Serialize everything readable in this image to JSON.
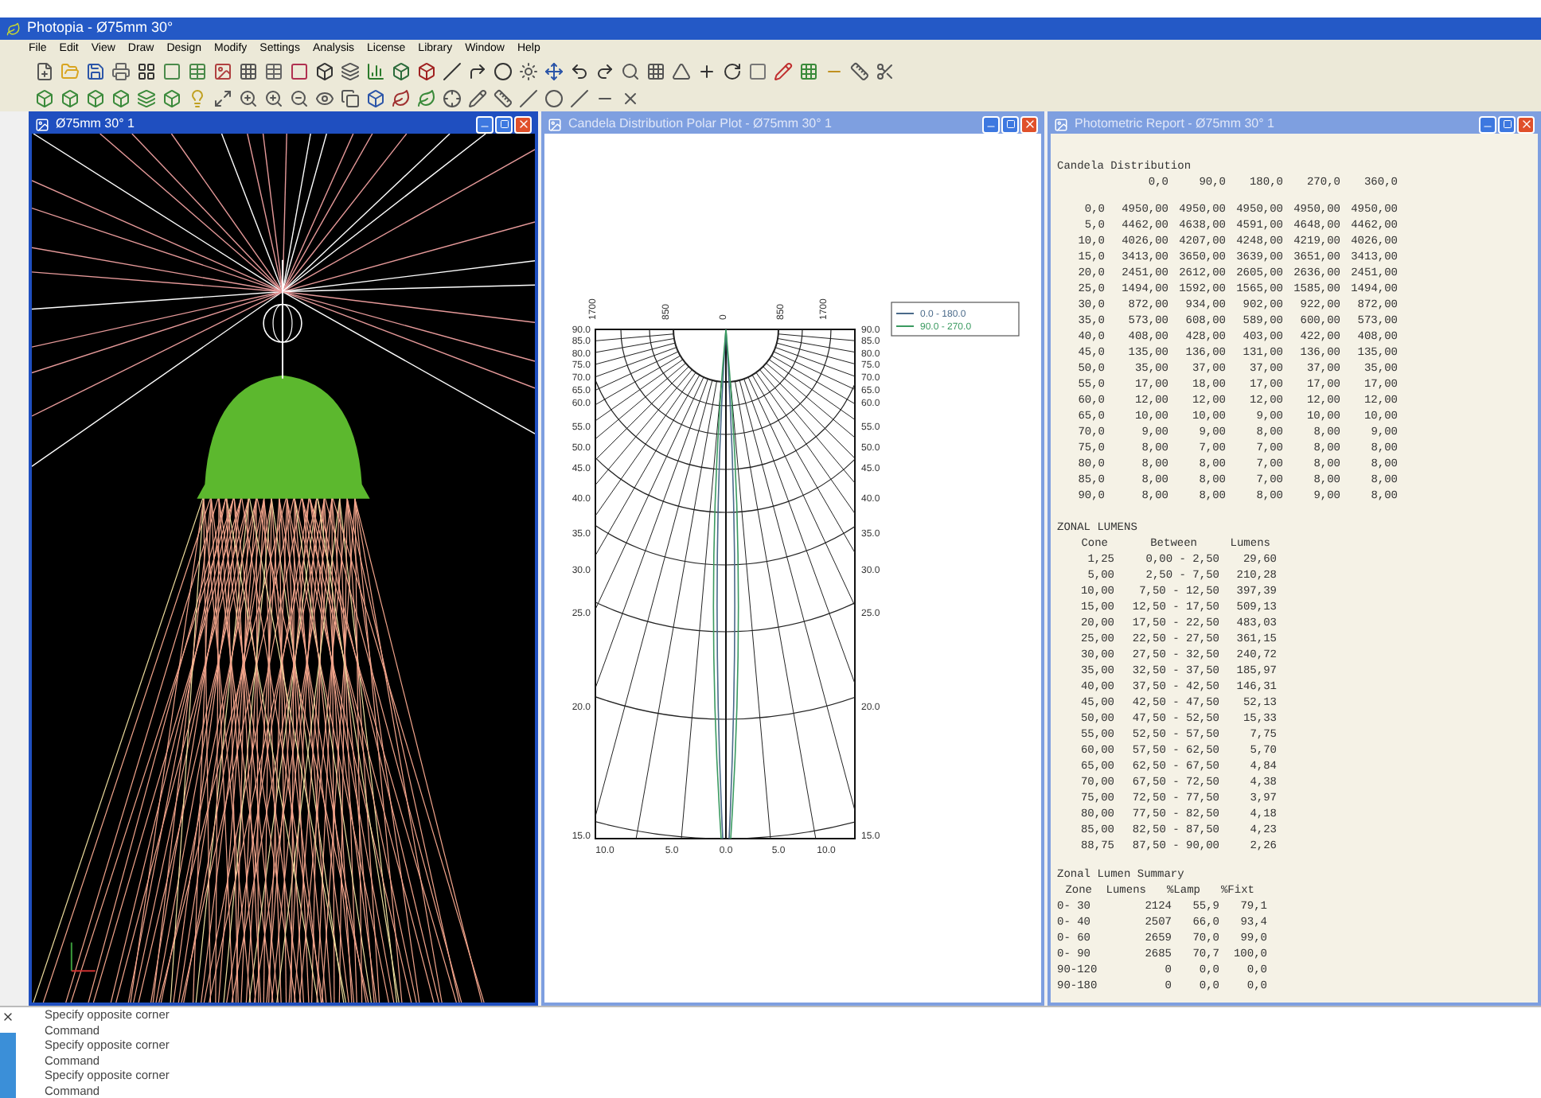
{
  "window": {
    "title": "Photopia - Ø75mm 30°"
  },
  "menu": [
    "File",
    "Edit",
    "View",
    "Draw",
    "Design",
    "Modify",
    "Settings",
    "Analysis",
    "License",
    "Library",
    "Window",
    "Help"
  ],
  "child_windows": [
    {
      "kind": "render",
      "title": "Ø75mm 30° 1",
      "selected": true
    },
    {
      "kind": "polar",
      "title": "Candela Distribution Polar Plot - Ø75mm 30° 1",
      "selected": false,
      "legend": [
        {
          "label": "0.0 - 180.0",
          "color": "#4a6a8a"
        },
        {
          "label": "90.0 - 270.0",
          "color": "#3a9a60"
        }
      ],
      "top_axis": [
        "1700",
        "850",
        "0",
        "850",
        "1700"
      ],
      "left_axis": [
        "90.0",
        "85.0",
        "80.0",
        "75.0",
        "70.0",
        "65.0",
        "60.0",
        "55.0",
        "50.0",
        "45.0",
        "40.0",
        "35.0",
        "30.0",
        "25.0",
        "20.0",
        "15.0"
      ],
      "right_axis": [
        "90.0",
        "85.0",
        "80.0",
        "75.0",
        "70.0",
        "65.0",
        "60.0",
        "55.0",
        "50.0",
        "45.0",
        "40.0",
        "35.0",
        "30.0",
        "25.0",
        "20.0",
        "15.0"
      ],
      "bottom_axis": [
        "10.0",
        "5.0",
        "0.0",
        "5.0",
        "10.0"
      ]
    },
    {
      "kind": "report",
      "title": "Photometric Report - Ø75mm 30° 1",
      "selected": false,
      "candela": {
        "title": "Candela Distribution",
        "columns": [
          "",
          "0,0",
          "90,0",
          "180,0",
          "270,0",
          "360,0"
        ],
        "rows": [
          [
            "0,0",
            "4950,00",
            "4950,00",
            "4950,00",
            "4950,00",
            "4950,00"
          ],
          [
            "5,0",
            "4462,00",
            "4638,00",
            "4591,00",
            "4648,00",
            "4462,00"
          ],
          [
            "10,0",
            "4026,00",
            "4207,00",
            "4248,00",
            "4219,00",
            "4026,00"
          ],
          [
            "15,0",
            "3413,00",
            "3650,00",
            "3639,00",
            "3651,00",
            "3413,00"
          ],
          [
            "20,0",
            "2451,00",
            "2612,00",
            "2605,00",
            "2636,00",
            "2451,00"
          ],
          [
            "25,0",
            "1494,00",
            "1592,00",
            "1565,00",
            "1585,00",
            "1494,00"
          ],
          [
            "30,0",
            "872,00",
            "934,00",
            "902,00",
            "922,00",
            "872,00"
          ],
          [
            "35,0",
            "573,00",
            "608,00",
            "589,00",
            "600,00",
            "573,00"
          ],
          [
            "40,0",
            "408,00",
            "428,00",
            "403,00",
            "422,00",
            "408,00"
          ],
          [
            "45,0",
            "135,00",
            "136,00",
            "131,00",
            "136,00",
            "135,00"
          ],
          [
            "50,0",
            "35,00",
            "37,00",
            "37,00",
            "37,00",
            "35,00"
          ],
          [
            "55,0",
            "17,00",
            "18,00",
            "17,00",
            "17,00",
            "17,00"
          ],
          [
            "60,0",
            "12,00",
            "12,00",
            "12,00",
            "12,00",
            "12,00"
          ],
          [
            "65,0",
            "10,00",
            "10,00",
            "9,00",
            "10,00",
            "10,00"
          ],
          [
            "70,0",
            "9,00",
            "9,00",
            "8,00",
            "8,00",
            "9,00"
          ],
          [
            "75,0",
            "8,00",
            "7,00",
            "7,00",
            "8,00",
            "8,00"
          ],
          [
            "80,0",
            "8,00",
            "8,00",
            "7,00",
            "8,00",
            "8,00"
          ],
          [
            "85,0",
            "8,00",
            "8,00",
            "7,00",
            "8,00",
            "8,00"
          ],
          [
            "90,0",
            "8,00",
            "8,00",
            "8,00",
            "9,00",
            "8,00"
          ]
        ]
      },
      "zonal": {
        "title": "ZONAL LUMENS",
        "columns": [
          "Cone",
          "Between",
          "Lumens"
        ],
        "rows": [
          [
            "1,25",
            "0,00 -  2,50",
            "29,60"
          ],
          [
            "5,00",
            "2,50 -  7,50",
            "210,28"
          ],
          [
            "10,00",
            "7,50 - 12,50",
            "397,39"
          ],
          [
            "15,00",
            "12,50 - 17,50",
            "509,13"
          ],
          [
            "20,00",
            "17,50 - 22,50",
            "483,03"
          ],
          [
            "25,00",
            "22,50 - 27,50",
            "361,15"
          ],
          [
            "30,00",
            "27,50 - 32,50",
            "240,72"
          ],
          [
            "35,00",
            "32,50 - 37,50",
            "185,97"
          ],
          [
            "40,00",
            "37,50 - 42,50",
            "146,31"
          ],
          [
            "45,00",
            "42,50 - 47,50",
            "52,13"
          ],
          [
            "50,00",
            "47,50 - 52,50",
            "15,33"
          ],
          [
            "55,00",
            "52,50 - 57,50",
            "7,75"
          ],
          [
            "60,00",
            "57,50 - 62,50",
            "5,70"
          ],
          [
            "65,00",
            "62,50 - 67,50",
            "4,84"
          ],
          [
            "70,00",
            "67,50 - 72,50",
            "4,38"
          ],
          [
            "75,00",
            "72,50 - 77,50",
            "3,97"
          ],
          [
            "80,00",
            "77,50 - 82,50",
            "4,18"
          ],
          [
            "85,00",
            "82,50 - 87,50",
            "4,23"
          ],
          [
            "88,75",
            "87,50 - 90,00",
            "2,26"
          ]
        ]
      },
      "summary": {
        "title": "Zonal Lumen Summary",
        "columns": [
          "Zone",
          "Lumens",
          "%Lamp",
          "%Fixt"
        ],
        "rows": [
          [
            "0- 30",
            "2124",
            "55,9",
            "79,1"
          ],
          [
            "0- 40",
            "2507",
            "66,0",
            "93,4"
          ],
          [
            "0- 60",
            "2659",
            "70,0",
            "99,0"
          ],
          [
            "0- 90",
            "2685",
            "70,7",
            "100,0"
          ],
          [
            "90-120",
            "0",
            "0,0",
            "0,0"
          ],
          [
            "90-180",
            "0",
            "0,0",
            "0,0"
          ]
        ]
      }
    }
  ],
  "command_lines": [
    "Specify opposite corner",
    "Command",
    "Specify opposite corner",
    "Command",
    "Specify opposite corner",
    "Command"
  ]
}
